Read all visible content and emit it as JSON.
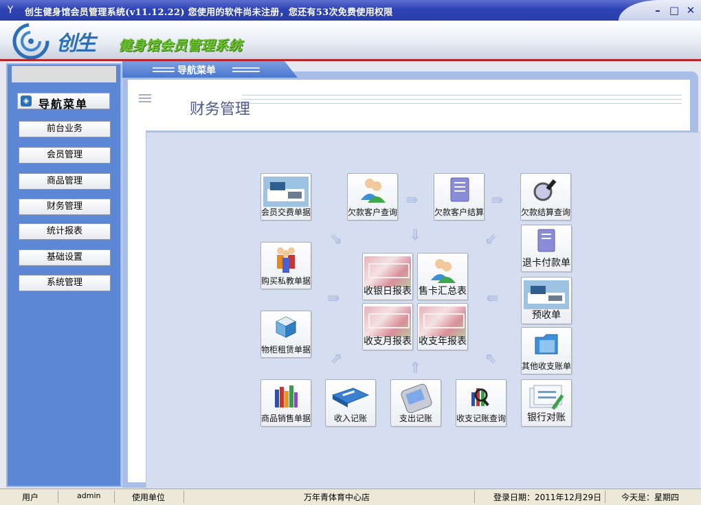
{
  "window": {
    "title": "创生健身馆会员管理系统(v11.12.22)  您使用的软件尚未注册，您还有53次免费使用权限",
    "minimize_icon": "minimize-icon",
    "maximize_icon": "maximize-icon",
    "close_icon": "close-icon"
  },
  "header": {
    "logo_text": "创生",
    "system_name": "健身馆会员管理系统"
  },
  "nav": {
    "tab_label": "导航菜单",
    "heading": "导航菜单",
    "items": [
      {
        "label": "前台业务"
      },
      {
        "label": "会员管理"
      },
      {
        "label": "商品管理"
      },
      {
        "label": "财务管理"
      },
      {
        "label": "统计报表"
      },
      {
        "label": "基础设置"
      },
      {
        "label": "系统管理"
      }
    ]
  },
  "page": {
    "title": "财务管理"
  },
  "tiles": {
    "member_fee": "会员交费单据",
    "debt_query": "欠款客户查询",
    "debt_settle": "欠款客户结算",
    "debt_settle_query": "欠款结算查询",
    "refund_card": "退卡付款单",
    "buy_private": "购买私教单据",
    "cash_daily": "收银日报表",
    "card_summary": "售卡汇总表",
    "prepaid": "预收单",
    "locker_rent": "物柜租赁单据",
    "monthly": "收支月报表",
    "yearly": "收支年报表",
    "other_income": "其他收支账单",
    "goods_sales": "商品销售单据",
    "income_record": "收入记账",
    "expense_record": "支出记账",
    "record_query": "收支记账查询",
    "bank_reconcile": "银行对账"
  },
  "status": {
    "user_label": "用户",
    "user_value": "admin",
    "unit_label": "使用单位",
    "unit_value": "万年青体育中心店",
    "login_date": "登录日期：2011年12月29日",
    "today": "今天是：星期四"
  },
  "colors": {
    "titlebar": "#2d43b5",
    "nav_panel": "#5b87d5",
    "canvas": "#d5ddf1",
    "accent_green": "#6cc42a",
    "header_red": "#b6262a"
  }
}
